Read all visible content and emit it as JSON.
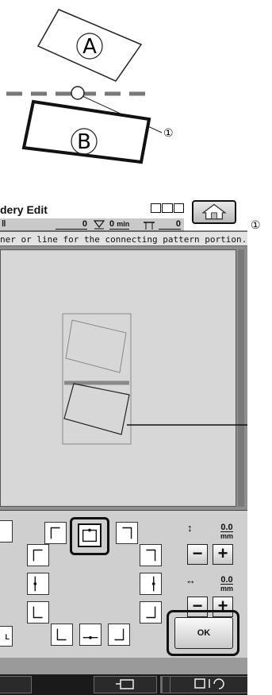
{
  "diagram": {
    "label_a": "A",
    "label_b": "B",
    "callout": "①"
  },
  "header": {
    "title": "dery Edit"
  },
  "status": {
    "value_1": "0",
    "value_2": "0",
    "unit_2": "min",
    "value_3": "0"
  },
  "instruction": "ner or line for the connecting pattern portion.",
  "canvas": {
    "callout": "①"
  },
  "controls": {
    "left_partial_label": "L",
    "vertical_value": "0.0",
    "vertical_unit": "mm",
    "horizontal_value": "0.0",
    "horizontal_unit": "mm",
    "minus_label": "−",
    "plus_label": "+",
    "ok_label": "OK"
  },
  "bottom_bar": {
    "help_label": "?"
  },
  "icons": {
    "home": "home-icon",
    "vertical_arrow": "vertical-arrow-icon",
    "horizontal_arrow": "horizontal-arrow-icon",
    "embroidery": "embroidery-frame-icon",
    "machine": "machine-needle-icon"
  }
}
